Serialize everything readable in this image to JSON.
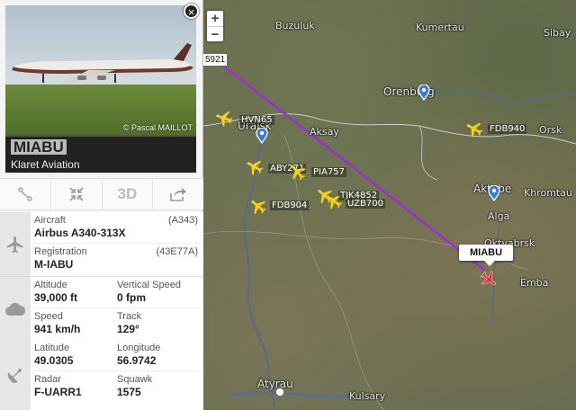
{
  "panel": {
    "registration": "MIABU",
    "airline": "Klaret Aviation",
    "photo_credit": "© Pascal MAILLOT",
    "close_symbol": "×",
    "tools": [
      {
        "name": "route-icon",
        "label": ""
      },
      {
        "name": "collapse-icon",
        "label": ""
      },
      {
        "name": "3d-button",
        "label": "3D"
      },
      {
        "name": "share-icon",
        "label": ""
      }
    ],
    "aircraft_label": "Aircraft",
    "aircraft_code": "(A343)",
    "aircraft_value": "Airbus A340-313X",
    "registration_label": "Registration",
    "registration_code": "(43E77A)",
    "registration_value": "M-IABU",
    "altitude_label": "Altitude",
    "altitude_value": "39,000 ft",
    "vs_label": "Vertical Speed",
    "vs_value": "0 fpm",
    "speed_label": "Speed",
    "speed_value": "941 km/h",
    "track_label": "Track",
    "track_value": "129°",
    "lat_label": "Latitude",
    "lat_value": "49.0305",
    "lon_label": "Longitude",
    "lon_value": "56.9742",
    "radar_label": "Radar",
    "radar_value": "F-UARR1",
    "squawk_label": "Squawk",
    "squawk_value": "1575"
  },
  "map": {
    "zoom_in": "+",
    "zoom_out": "−",
    "selected_label": "MIABU",
    "edge_label": "5921",
    "cities": [
      "Buzuluk",
      "Kumertau",
      "Sibay",
      "Orenburg",
      "Orsk",
      "Uralsk",
      "Aksay",
      "Aktobe",
      "Khromtau",
      "Alga",
      "Oktyabrsk",
      "Emba",
      "Atyrau",
      "Kulsary"
    ],
    "aircraft": [
      "HVN65",
      "FDB940",
      "ABY271",
      "PIA757",
      "TJK4852",
      "UZB700",
      "FDB904"
    ],
    "colors": {
      "track": "#9b2fd1",
      "plane": "#f5d11c",
      "selected_plane": "#e03030"
    }
  }
}
